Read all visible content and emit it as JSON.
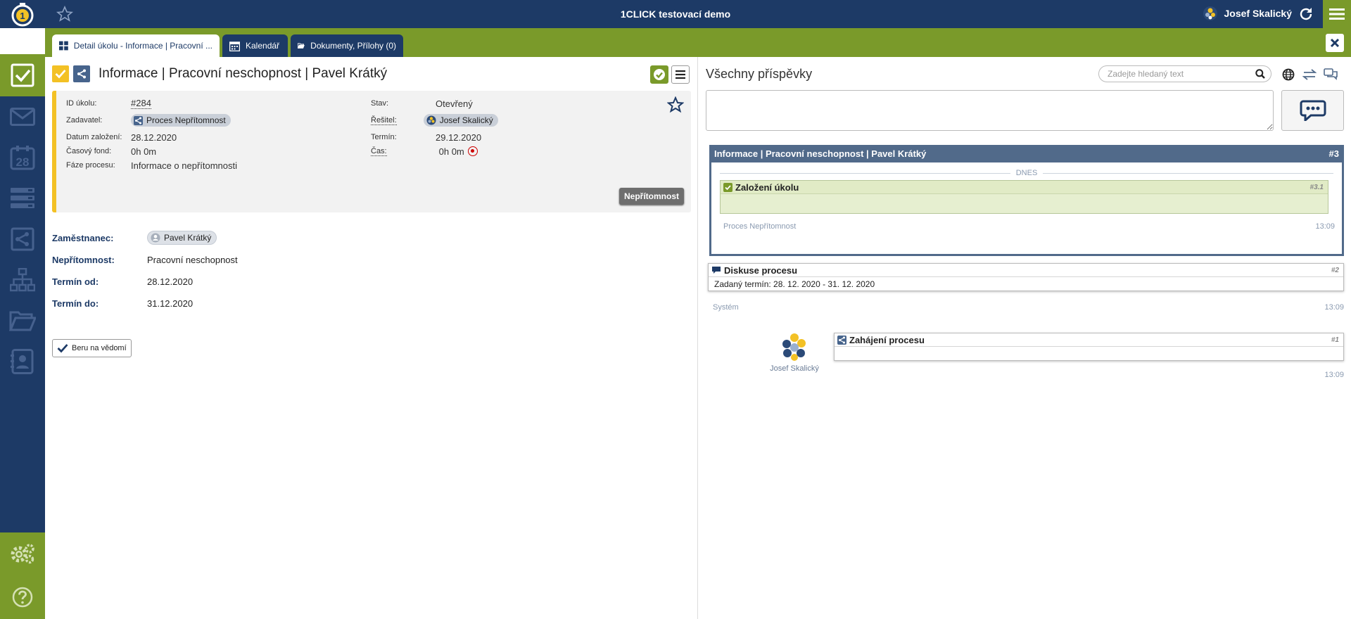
{
  "topbar": {
    "app_title": "1CLICK testovací demo",
    "user_name": "Josef Skalický"
  },
  "tabs": [
    {
      "label": "Detail úkolu - Informace | Pracovní ..."
    },
    {
      "label": "Kalendář"
    },
    {
      "label": "Dokumenty, Přílohy (0)"
    }
  ],
  "sidebar": {
    "calendar_day": "28",
    "items": [
      "Úkoly",
      "Zprávy",
      "Kalendář",
      "Seznamy",
      "Procesy",
      "Organizace",
      "Dokumenty",
      "Kontakty",
      "Nastavení",
      "Nápověda"
    ]
  },
  "task": {
    "title": "Informace | Pracovní neschopnost | Pavel Krátký",
    "info": {
      "id_label": "ID úkolu:",
      "id_value": "#284",
      "zadavatel_label": "Zadavatel:",
      "zadavatel_value": "Proces Nepřítomnost",
      "datum_label": "Datum založení:",
      "datum_value": "28.12.2020",
      "fond_label": "Časový fond:",
      "fond_value": "0h 0m",
      "faze_label": "Fáze procesu:",
      "faze_value": "Informace o nepřítomnosti",
      "stav_label": "Stav:",
      "stav_value": "Otevřený",
      "resitel_label": "Řešitel:",
      "resitel_value": "Josef Skalický",
      "termin_label": "Termín:",
      "termin_value": "29.12.2020",
      "cas_label": "Čas:",
      "cas_value": "0h 0m"
    },
    "category_button": "Nepřítomnost",
    "fields": [
      {
        "label": "Zaměstnanec:",
        "value": "Pavel Krátký"
      },
      {
        "label": "Nepřítomnost:",
        "value": "Pracovní neschopnost"
      },
      {
        "label": "Termín od:",
        "value": "28.12.2020"
      },
      {
        "label": "Termín do:",
        "value": "31.12.2020"
      }
    ],
    "ack_button": "Beru na vědomí"
  },
  "posts": {
    "title": "Všechny příspěvky",
    "search_placeholder": "Zadejte hledaný text",
    "thread": {
      "title": "Informace | Pracovní neschopnost | Pavel Krátký",
      "number": "#3",
      "day_separator": "DNES",
      "message": {
        "title": "Založení úkolu",
        "number": "#3.1",
        "author": "Proces Nepřítomnost",
        "time": "13:09"
      }
    },
    "discussion": {
      "title": "Diskuse procesu",
      "number": "#2",
      "body": "Zadaný termín: 28. 12. 2020 - 31. 12. 2020",
      "author": "Systém",
      "time": "13:09"
    },
    "start": {
      "title": "Zahájení procesu",
      "number": "#1",
      "author": "Josef Skalický",
      "time": "13:09"
    }
  },
  "colors": {
    "navy": "#1d3a66",
    "green": "#7a9a2a",
    "yellow": "#f3c125",
    "slate": "#516a8a"
  }
}
